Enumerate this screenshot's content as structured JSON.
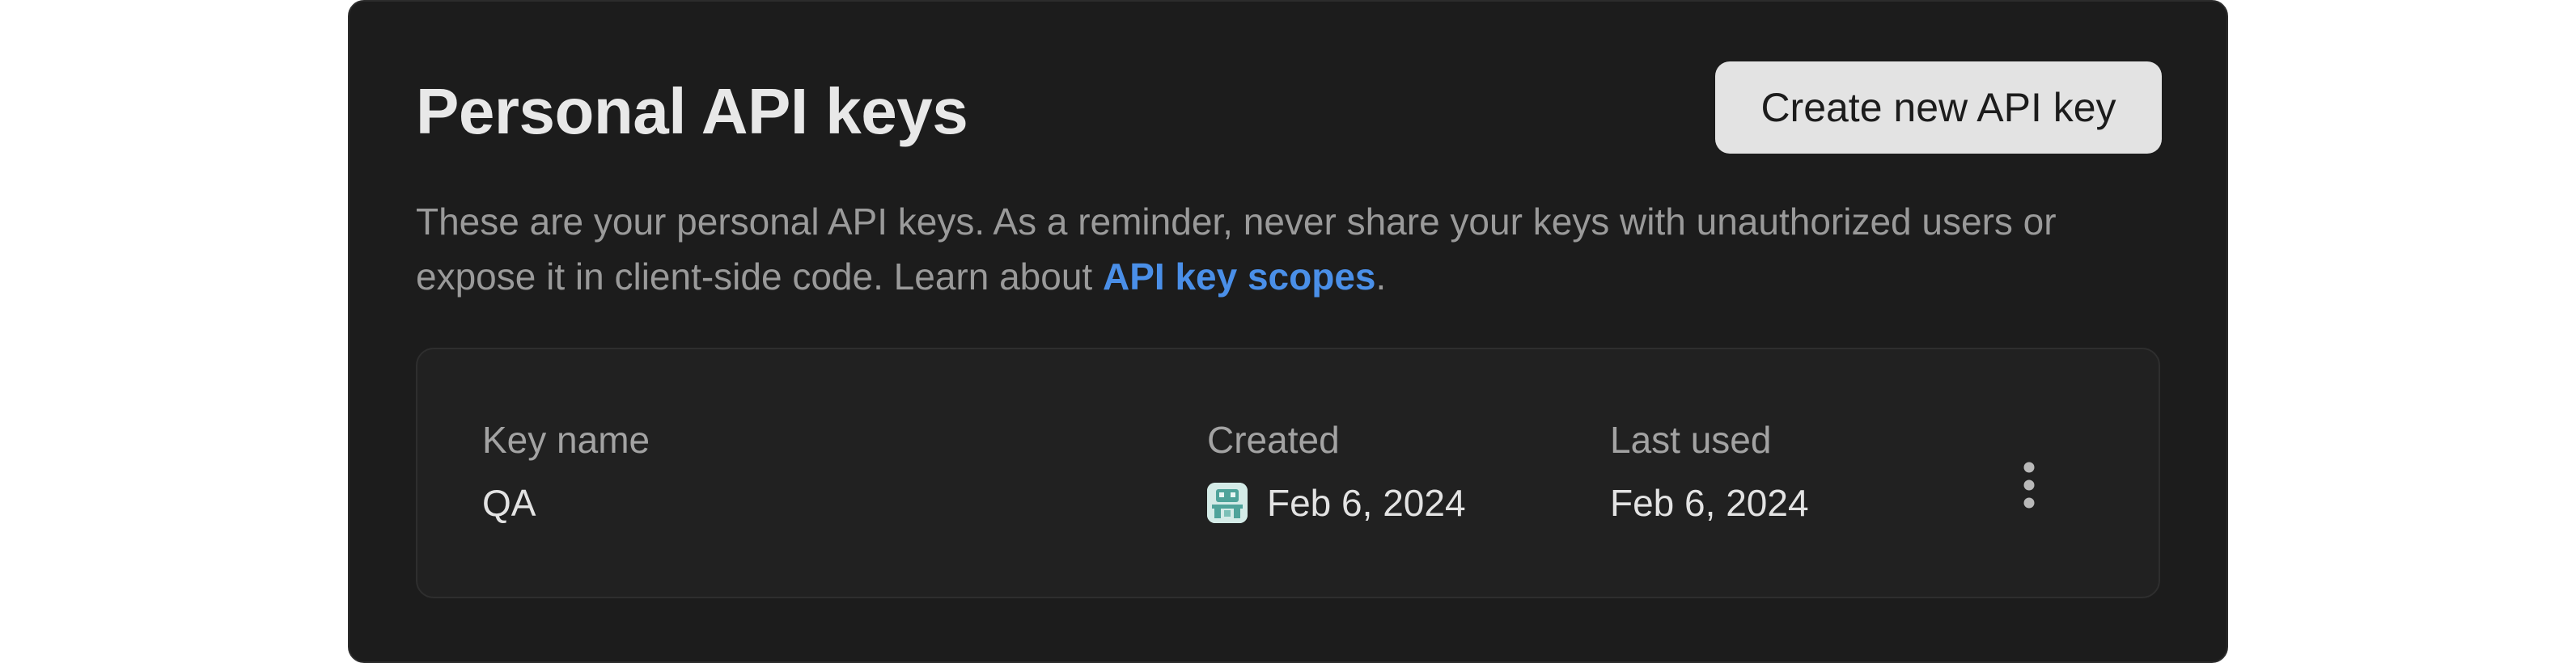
{
  "header": {
    "title": "Personal API keys",
    "create_button_label": "Create new API key"
  },
  "description": {
    "text_before_link": "These are your personal API keys. As a reminder, never share your keys with unauthorized users or expose it in client-side code. Learn about ",
    "link_label": "API key scopes",
    "text_after_link": "."
  },
  "table": {
    "columns": {
      "key_name": "Key name",
      "created": "Created",
      "last_used": "Last used"
    },
    "rows": [
      {
        "key_name": "QA",
        "created": "Feb 6, 2024",
        "last_used": "Feb 6, 2024",
        "creator_avatar_icon": "user-avatar-icon",
        "actions_icon": "more-vertical-icon"
      }
    ]
  },
  "colors": {
    "panel_background": "#1c1c1c",
    "link": "#4a8fe8",
    "button_background": "#e3e3e3"
  }
}
